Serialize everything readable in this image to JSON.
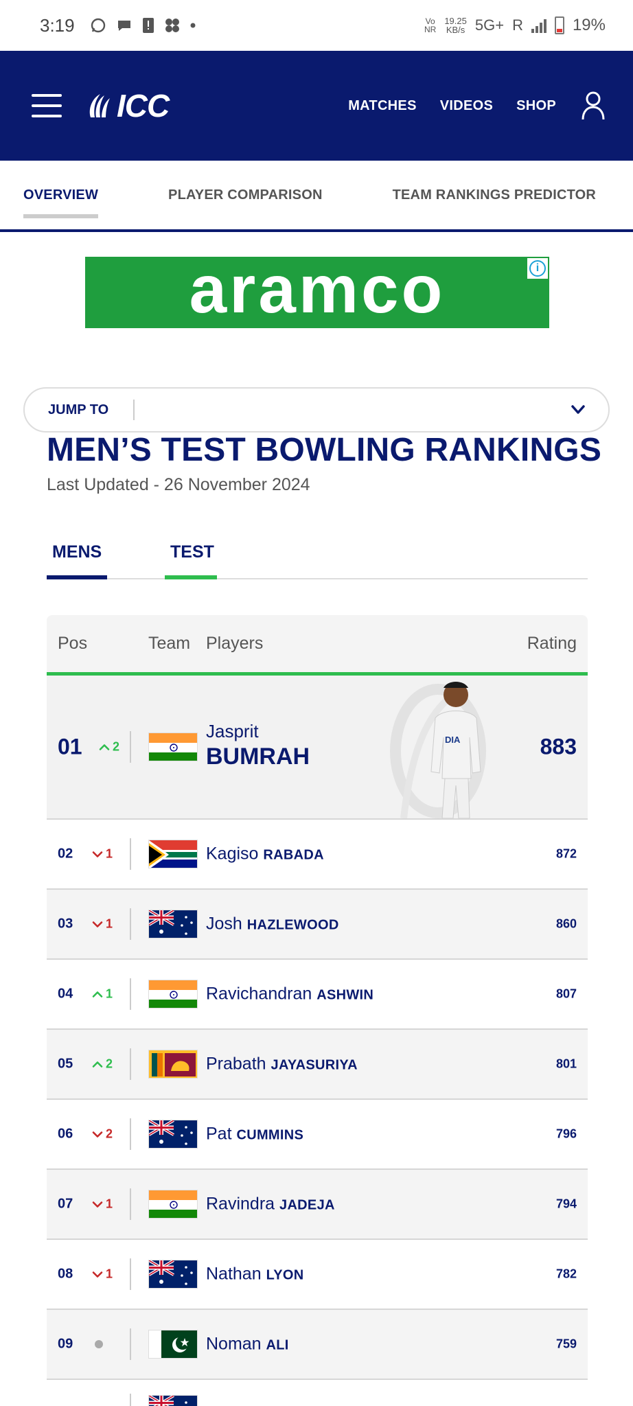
{
  "status_bar": {
    "time": "3:19",
    "network_top": "Vo",
    "network_bottom": "NR",
    "rate_top": "19.25",
    "rate_bottom": "KB/s",
    "network_type": "5G+",
    "roaming": "R",
    "battery": "19%"
  },
  "header": {
    "logo_text": "ICC",
    "nav": [
      "MATCHES",
      "VIDEOS",
      "SHOP"
    ]
  },
  "subtabs": [
    "OVERVIEW",
    "PLAYER COMPARISON",
    "TEAM RANKINGS PREDICTOR"
  ],
  "ad": {
    "brand": "aramco"
  },
  "jump": {
    "label": "JUMP TO"
  },
  "page": {
    "title": "MEN’S TEST BOWLING RANKINGS",
    "updated": "Last Updated - 26 November 2024"
  },
  "filters": [
    "MENS",
    "TEST"
  ],
  "table": {
    "headers": {
      "pos": "Pos",
      "team": "Team",
      "players": "Players",
      "rating": "Rating"
    },
    "rows": [
      {
        "pos": "01",
        "move": "2",
        "dir": "up",
        "flag": "india",
        "first": "Jasprit",
        "last": "BUMRAH",
        "rating": "883"
      },
      {
        "pos": "02",
        "move": "1",
        "dir": "down",
        "flag": "south-africa",
        "first": "Kagiso",
        "last": "RABADA",
        "rating": "872"
      },
      {
        "pos": "03",
        "move": "1",
        "dir": "down",
        "flag": "australia",
        "first": "Josh",
        "last": "HAZLEWOOD",
        "rating": "860"
      },
      {
        "pos": "04",
        "move": "1",
        "dir": "up",
        "flag": "india",
        "first": "Ravichandran",
        "last": "ASHWIN",
        "rating": "807"
      },
      {
        "pos": "05",
        "move": "2",
        "dir": "up",
        "flag": "sri-lanka",
        "first": "Prabath",
        "last": "JAYASURIYA",
        "rating": "801"
      },
      {
        "pos": "06",
        "move": "2",
        "dir": "down",
        "flag": "australia",
        "first": "Pat",
        "last": "CUMMINS",
        "rating": "796"
      },
      {
        "pos": "07",
        "move": "1",
        "dir": "down",
        "flag": "india",
        "first": "Ravindra",
        "last": "JADEJA",
        "rating": "794"
      },
      {
        "pos": "08",
        "move": "1",
        "dir": "down",
        "flag": "australia",
        "first": "Nathan",
        "last": "LYON",
        "rating": "782"
      },
      {
        "pos": "09",
        "move": "",
        "dir": "none",
        "flag": "pakistan",
        "first": "Noman",
        "last": "ALI",
        "rating": "759"
      }
    ]
  },
  "colors": {
    "navy": "#0a1a6e",
    "green": "#2ebd4e",
    "red": "#c62828",
    "ad_green": "#1f9e3e"
  }
}
